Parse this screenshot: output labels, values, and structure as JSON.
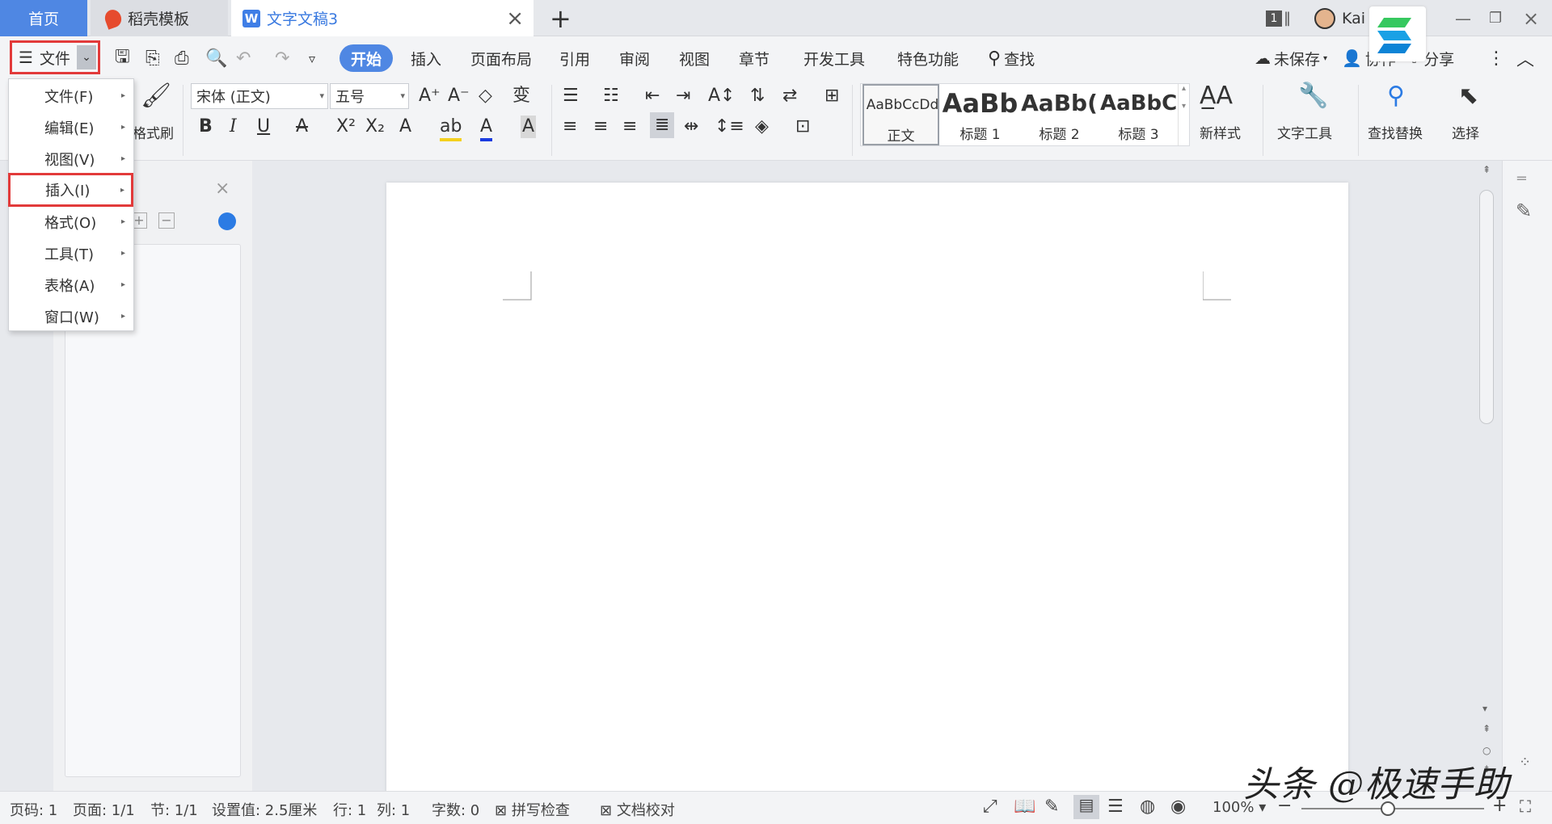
{
  "tabs": {
    "home": "首页",
    "template": "稻壳模板",
    "document": "文字文稿3",
    "new_tab": "+"
  },
  "titlebar": {
    "window_count": "1",
    "user": "Kai"
  },
  "menubar": {
    "file": "文件",
    "items": [
      "开始",
      "插入",
      "页面布局",
      "引用",
      "审阅",
      "视图",
      "章节",
      "开发工具",
      "特色功能"
    ],
    "search": "查找",
    "unsaved": "未保存",
    "collab": "协作",
    "share": "分享"
  },
  "ribbon": {
    "format_painter": "格式刷",
    "font_name": "宋体 (正文)",
    "font_size": "五号",
    "styles": [
      {
        "preview": "AaBbCcDd",
        "label": "正文"
      },
      {
        "preview": "AaBb",
        "label": "标题 1"
      },
      {
        "preview": "AaBb(",
        "label": "标题 2"
      },
      {
        "preview": "AaBbC",
        "label": "标题 3"
      }
    ],
    "new_style": "新样式",
    "text_tools": "文字工具",
    "find_replace": "查找替换",
    "select": "选择"
  },
  "file_menu": {
    "items": [
      "文件(F)",
      "编辑(E)",
      "视图(V)",
      "插入(I)",
      "格式(O)",
      "工具(T)",
      "表格(A)",
      "窗口(W)"
    ],
    "highlighted_index": 3
  },
  "statusbar": {
    "page_num": "页码: 1",
    "pages": "页面: 1/1",
    "section": "节: 1/1",
    "setting": "设置值: 2.5厘米",
    "row": "行: 1",
    "col": "列: 1",
    "word_count": "字数: 0",
    "spell_check": "拼写检查",
    "doc_check": "文档校对",
    "zoom": "100%"
  },
  "watermark": "头条 @极速手助",
  "colors": {
    "accent": "#4f87e3",
    "highlight_border": "#e23a3a"
  }
}
